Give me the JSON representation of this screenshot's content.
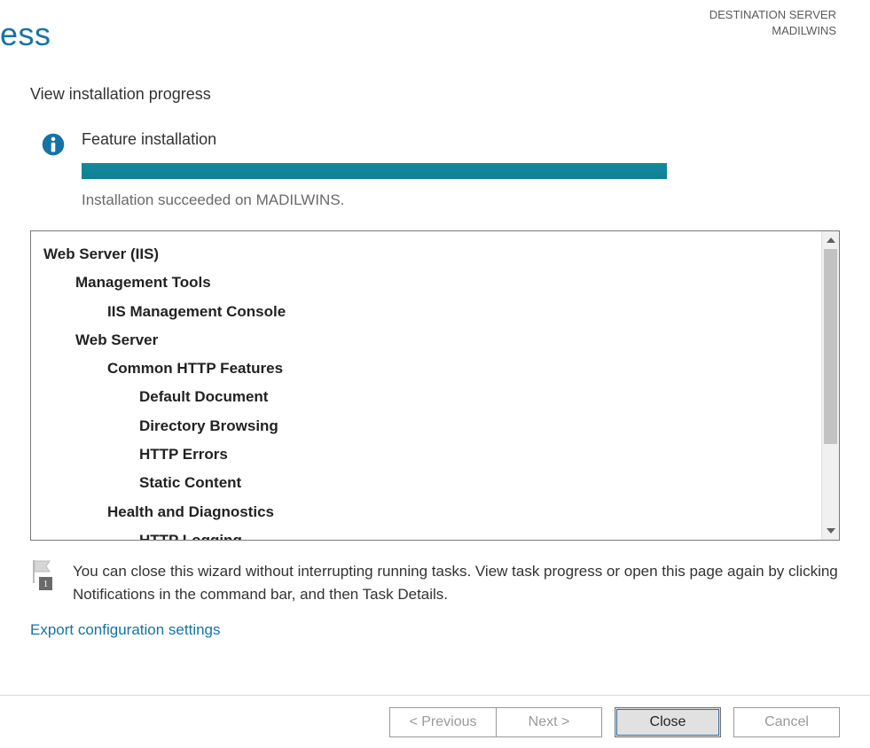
{
  "header": {
    "title_fragment": "ess",
    "dest_label": "DESTINATION SERVER",
    "dest_value": "MADILWINS"
  },
  "content": {
    "subheading": "View installation progress",
    "feature_title": "Feature installation",
    "status_text": "Installation succeeded on MADILWINS.",
    "tree": {
      "l0": "Web Server (IIS)",
      "l1a": "Management Tools",
      "l2a": "IIS Management Console",
      "l1b": "Web Server",
      "l2b": "Common HTTP Features",
      "l3a": "Default Document",
      "l3b": "Directory Browsing",
      "l3c": "HTTP Errors",
      "l3d": "Static Content",
      "l2c": "Health and Diagnostics",
      "l3e": "HTTP Logging"
    },
    "hint_text": "You can close this wizard without interrupting running tasks. View task progress or open this page again by clicking Notifications in the command bar, and then Task Details.",
    "export_link": "Export configuration settings",
    "flag_badge": "1"
  },
  "footer": {
    "previous": "< Previous",
    "next": "Next >",
    "close": "Close",
    "cancel": "Cancel"
  }
}
